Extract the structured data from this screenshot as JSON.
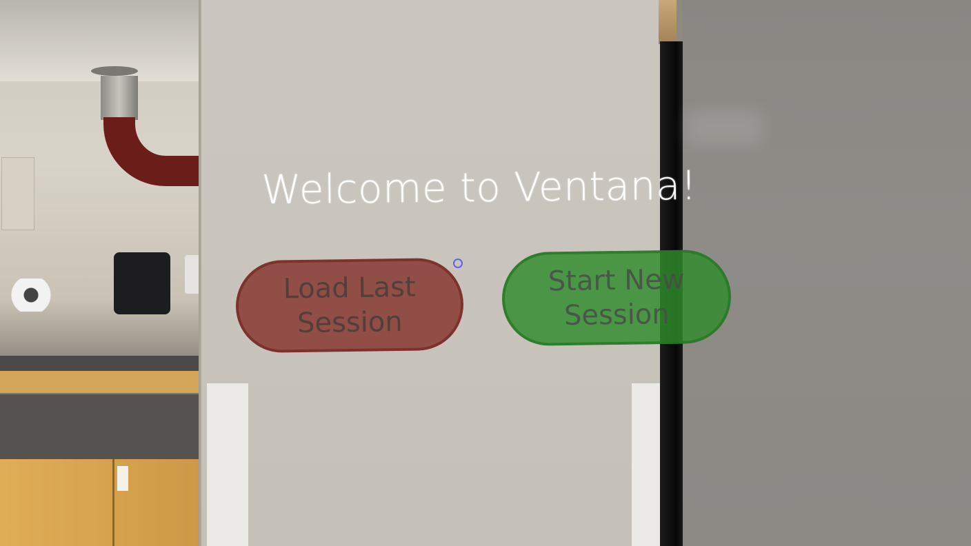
{
  "app": {
    "title": "Welcome to Ventana!"
  },
  "buttons": {
    "load_label": "Load Last\nSession",
    "start_label": "Start New\nSession"
  },
  "colors": {
    "title": "#ffffff",
    "load_button": "#822d26",
    "start_button": "#308c2c",
    "cursor": "#5a66e6"
  },
  "icons": {
    "cursor": "gaze-cursor-ring"
  }
}
